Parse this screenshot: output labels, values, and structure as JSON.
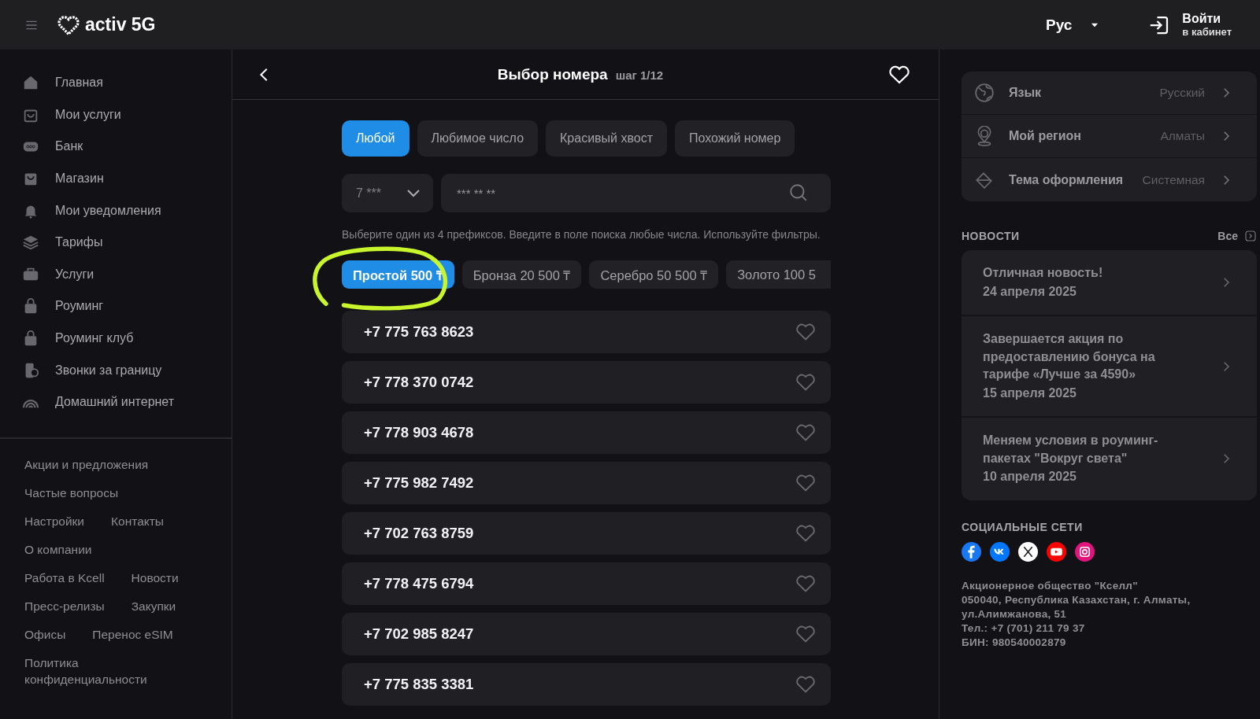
{
  "header": {
    "logo": "activ 5G",
    "language": "Рус",
    "login": {
      "title": "Войти",
      "subtitle": "в кабинет"
    }
  },
  "sidebar": {
    "items": [
      {
        "kind": "home",
        "label": "Главная"
      },
      {
        "kind": "bag",
        "label": "Мои услуги"
      },
      {
        "kind": "bank",
        "label": "Банк"
      },
      {
        "kind": "shop",
        "label": "Магазин"
      },
      {
        "kind": "bell",
        "label": "Мои уведомления"
      },
      {
        "kind": "layers",
        "label": "Тарифы"
      },
      {
        "kind": "case",
        "label": "Услуги"
      },
      {
        "kind": "lock",
        "label": "Роуминг"
      },
      {
        "kind": "lock",
        "label": "Роуминг клуб"
      },
      {
        "kind": "phone",
        "label": "Звонки за границу"
      },
      {
        "kind": "wifi",
        "label": "Домашний интернет"
      }
    ],
    "links": [
      [
        "Акции и предложения"
      ],
      [
        "Частые вопросы"
      ],
      [
        "Настройки",
        "Контакты"
      ],
      [
        "О компании"
      ],
      [
        "Работа в Kcell",
        "Новости"
      ],
      [
        "Пресс-релизы",
        "Закупки"
      ],
      [
        "Офисы",
        "Перенос eSIM"
      ],
      [
        "Политика конфиденциальности"
      ]
    ]
  },
  "main": {
    "title": "Выбор номера",
    "step": "шаг 1/12",
    "tabs": [
      {
        "label": "Любой",
        "selected": true
      },
      {
        "label": "Любимое число",
        "selected": false
      },
      {
        "label": "Красивый хвост",
        "selected": false
      },
      {
        "label": "Похожий номер",
        "selected": false
      }
    ],
    "prefix": {
      "value": "7 ***"
    },
    "search": {
      "placeholder": "*** ** **"
    },
    "hint": "Выберите один из 4 префиксов. Введите в поле поиска любые числа. Используйте фильтры.",
    "price_filters": [
      {
        "label": "Простой 500 ₸",
        "selected": true,
        "highlighted": true
      },
      {
        "label": "Бронза 20 500 ₸",
        "selected": false,
        "highlighted": false
      },
      {
        "label": "Серебро 50 500 ₸",
        "selected": false,
        "highlighted": false
      },
      {
        "label": "Золото 100 5",
        "selected": false,
        "highlighted": false
      }
    ],
    "numbers": [
      "+7 775 763 8623",
      "+7 778 370 0742",
      "+7 778 903 4678",
      "+7 775 982 7492",
      "+7 702 763 8759",
      "+7 778 475 6794",
      "+7 702 985 8247",
      "+7 775 835 3381"
    ]
  },
  "right_panel": {
    "settings": [
      {
        "kind": "globe",
        "label": "Язык",
        "value": "Русский"
      },
      {
        "kind": "pin",
        "label": "Мой регион",
        "value": "Алматы"
      },
      {
        "kind": "paint",
        "label": "Тема оформления",
        "value": "Системная"
      }
    ],
    "news_title": "НОВОСТИ",
    "news_all": "Все",
    "news": [
      {
        "title": "Отличная новость!",
        "date": "24 апреля 2025"
      },
      {
        "title": "Завершается акция по предоставлению бонуса на тарифе «Лучше за 4590»",
        "date": "15 апреля 2025"
      },
      {
        "title": "Меняем условия в роуминг-пакетах \"Вокруг света\"",
        "date": "10 апреля 2025"
      }
    ],
    "social_title": "СОЦИАЛЬНЫЕ СЕТИ",
    "social": [
      {
        "kind": "facebook",
        "color": "#1877f2"
      },
      {
        "kind": "vk",
        "color": "#0077ff"
      },
      {
        "kind": "x",
        "color": "#ffffff"
      },
      {
        "kind": "youtube",
        "color": "#ff0000"
      },
      {
        "kind": "instagram",
        "color": "#e1137d"
      }
    ],
    "company": [
      "Акционерное общество \"Кселл\"",
      "050040, Республика Казахстан, г. Алматы,",
      "ул.Алимжанова, 51",
      "Тел.: +7 (701) 211 79 37",
      "БИН: 980540002879"
    ]
  }
}
